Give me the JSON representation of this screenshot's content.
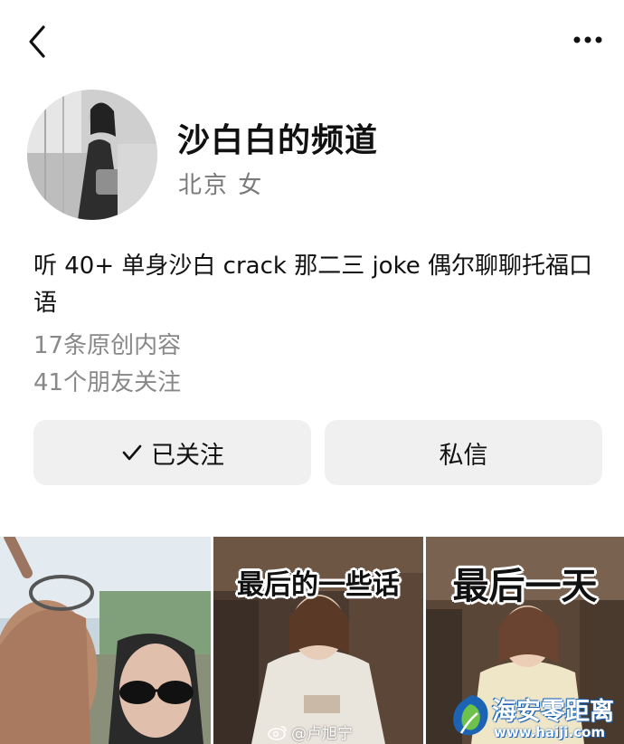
{
  "header": {
    "back_icon": "chevron-left-icon",
    "more_icon": "more-dots-icon"
  },
  "profile": {
    "name": "沙白白的频道",
    "meta": "北京 女",
    "bio": "听 40+ 单身沙白 crack 那二三 joke 偶尔聊聊托福口语",
    "original_count": "17条原创内容",
    "friends_following": "41个朋友关注"
  },
  "actions": {
    "follow_label": "已关注",
    "follow_icon": "check-icon",
    "message_label": "私信"
  },
  "videos": [
    {
      "caption": ""
    },
    {
      "caption": "最后的一些话"
    },
    {
      "caption": "最后一天"
    }
  ],
  "watermarks": {
    "weibo": "@卢旭宁",
    "site_name": "海安零距离",
    "site_url": "www.haiji.com"
  },
  "colors": {
    "button_bg": "#f0f0f0",
    "secondary_text": "#888888",
    "logo_blue": "#1c64b3",
    "logo_green": "#6cc24a"
  }
}
